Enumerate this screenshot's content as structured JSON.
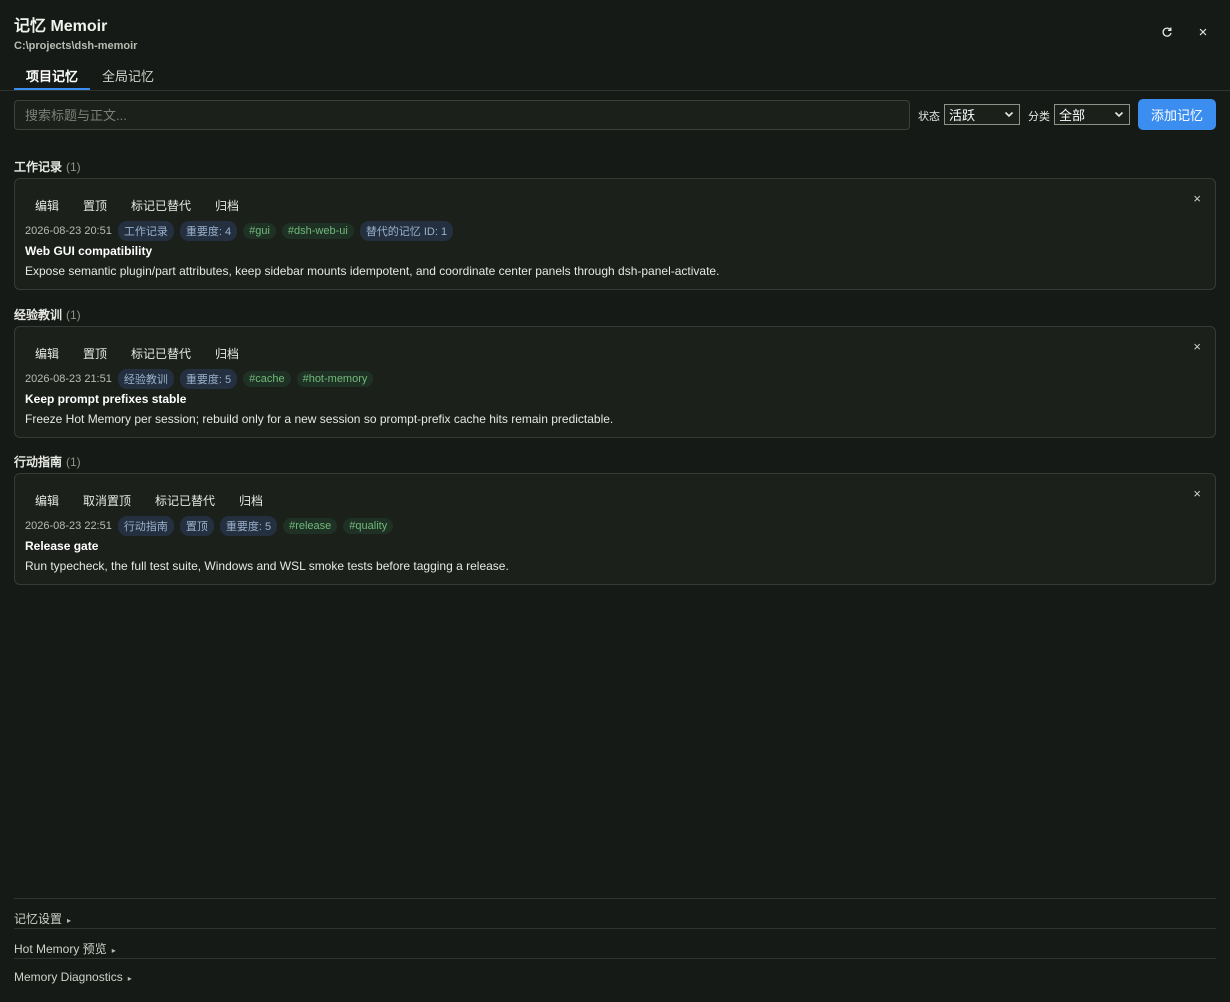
{
  "app": {
    "title": "记忆 Memoir",
    "path": "C:\\projects\\dsh-memoir"
  },
  "tabs": [
    {
      "label": "项目记忆",
      "active": true
    },
    {
      "label": "全局记忆",
      "active": false
    }
  ],
  "toolbar": {
    "search_placeholder": "搜索标题与正文...",
    "status_label": "状态",
    "status_value": "活跃",
    "category_label": "分类",
    "category_value": "全部",
    "add_label": "添加记忆"
  },
  "colors": {
    "accent": "#3b8ef0",
    "background": "#161a16",
    "card": "#1b201b"
  },
  "sections": [
    {
      "title": "工作记录",
      "count": "(1)",
      "card": {
        "actions": [
          "编辑",
          "置顶",
          "标记已替代",
          "归档"
        ],
        "date": "2026-08-23 20:51",
        "pills": [
          "工作记录",
          "重要度: 4"
        ],
        "tags": [
          "#gui",
          "#dsh-web-ui"
        ],
        "extra_pill": "替代的记忆 ID: 1",
        "title": "Web GUI compatibility",
        "body": "Expose semantic plugin/part attributes, keep sidebar mounts idempotent, and coordinate center panels through dsh-panel-activate."
      }
    },
    {
      "title": "经验教训",
      "count": "(1)",
      "card": {
        "actions": [
          "编辑",
          "置顶",
          "标记已替代",
          "归档"
        ],
        "date": "2026-08-23 21:51",
        "pills": [
          "经验教训",
          "重要度: 5"
        ],
        "tags": [
          "#cache",
          "#hot-memory"
        ],
        "title": "Keep prompt prefixes stable",
        "body": "Freeze Hot Memory per session; rebuild only for a new session so prompt-prefix cache hits remain predictable."
      }
    },
    {
      "title": "行动指南",
      "count": "(1)",
      "card": {
        "actions": [
          "编辑",
          "取消置顶",
          "标记已替代",
          "归档"
        ],
        "date": "2026-08-23 22:51",
        "pills": [
          "行动指南",
          "置顶",
          "重要度: 5"
        ],
        "tags": [
          "#release",
          "#quality"
        ],
        "title": "Release gate",
        "body": "Run typecheck, the full test suite, Windows and WSL smoke tests before tagging a release."
      }
    }
  ],
  "footer": {
    "settings": "记忆设置",
    "hot_memory": "Hot Memory 预览",
    "diagnostics": "Memory Diagnostics"
  }
}
